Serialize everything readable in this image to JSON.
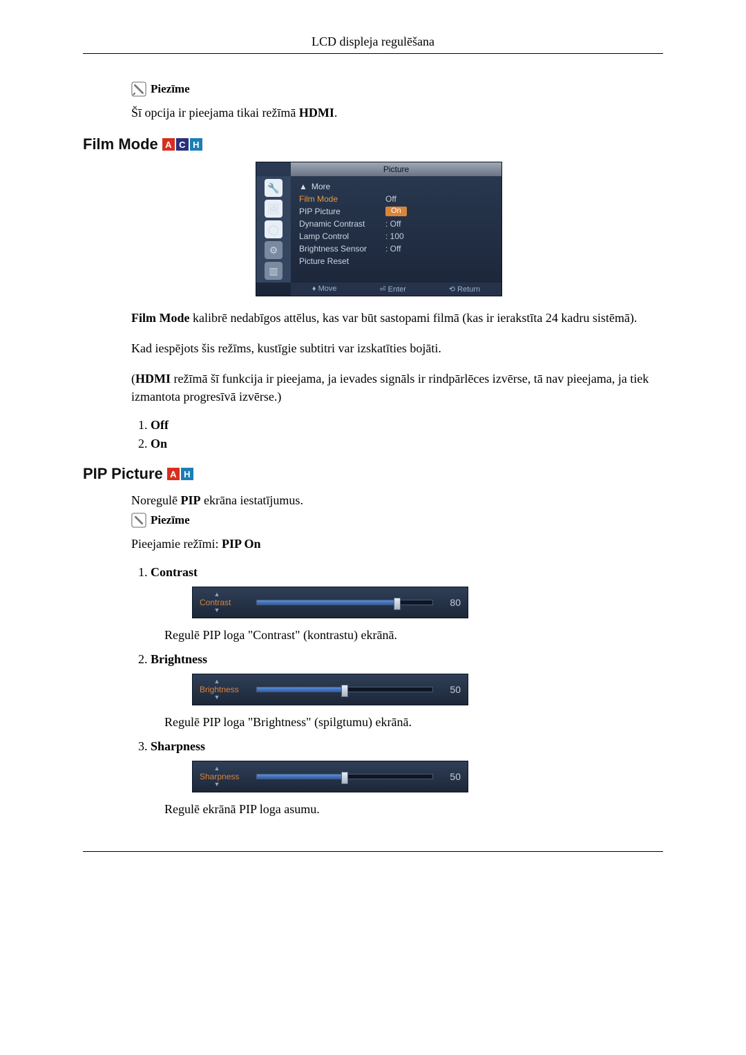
{
  "header": {
    "title": "LCD displeja regulēšana"
  },
  "note1": {
    "label": "Piezīme",
    "text_prefix": "Šī opcija ir pieejama tikai režīmā ",
    "text_bold": "HDMI",
    "text_suffix": "."
  },
  "section_film": {
    "heading": "Film Mode",
    "badges": [
      "A",
      "C",
      "H"
    ],
    "osd": {
      "title": "Picture",
      "more": "More",
      "rows": [
        {
          "label": "Film Mode",
          "value": "Off",
          "highlight": true,
          "selected": false
        },
        {
          "label": "PIP Picture",
          "value": "On",
          "selected": true
        },
        {
          "label": "Dynamic Contrast",
          "value": ": Off"
        },
        {
          "label": "Lamp Control",
          "value": ": 100"
        },
        {
          "label": "Brightness Sensor",
          "value": ": Off"
        },
        {
          "label": "Picture Reset",
          "value": ""
        }
      ],
      "footer": {
        "move": "Move",
        "enter": "Enter",
        "return": "Return"
      }
    },
    "para1_bold": "Film Mode",
    "para1_rest": " kalibrē nedabīgos attēlus, kas var būt sastopami filmā (kas ir ierakstīta 24 kadru sistēmā).",
    "para2": "Kad iespējots šis režīms, kustīgie subtitri var izskatīties bojāti.",
    "para3_pre": "(",
    "para3_bold": "HDMI",
    "para3_rest": " režīmā šī funkcija ir pieejama, ja ievades signāls ir rindpārlēces izvērse, tā nav pieejama, ja tiek izmantota progresīvā izvērse.)",
    "options": [
      "Off",
      "On"
    ]
  },
  "section_pip": {
    "heading": "PIP Picture",
    "badges": [
      "A",
      "H"
    ],
    "intro_pre": "Noregulē ",
    "intro_bold": "PIP",
    "intro_post": " ekrāna iestatījumus.",
    "note_label": "Piezīme",
    "modes_pre": "Pieejamie režīmi: ",
    "modes_bold": "PIP On",
    "items": [
      {
        "title": "Contrast",
        "slider": {
          "label": "Contrast",
          "value": 80,
          "max": 100
        },
        "desc": "Regulē PIP loga \"Contrast\" (kontrastu) ekrānā."
      },
      {
        "title": "Brightness",
        "slider": {
          "label": "Brightness",
          "value": 50,
          "max": 100
        },
        "desc": "Regulē PIP loga \"Brightness\" (spilgtumu) ekrānā."
      },
      {
        "title": "Sharpness",
        "slider": {
          "label": "Sharpness",
          "value": 50,
          "max": 100
        },
        "desc": "Regulē ekrānā PIP loga asumu."
      }
    ]
  }
}
